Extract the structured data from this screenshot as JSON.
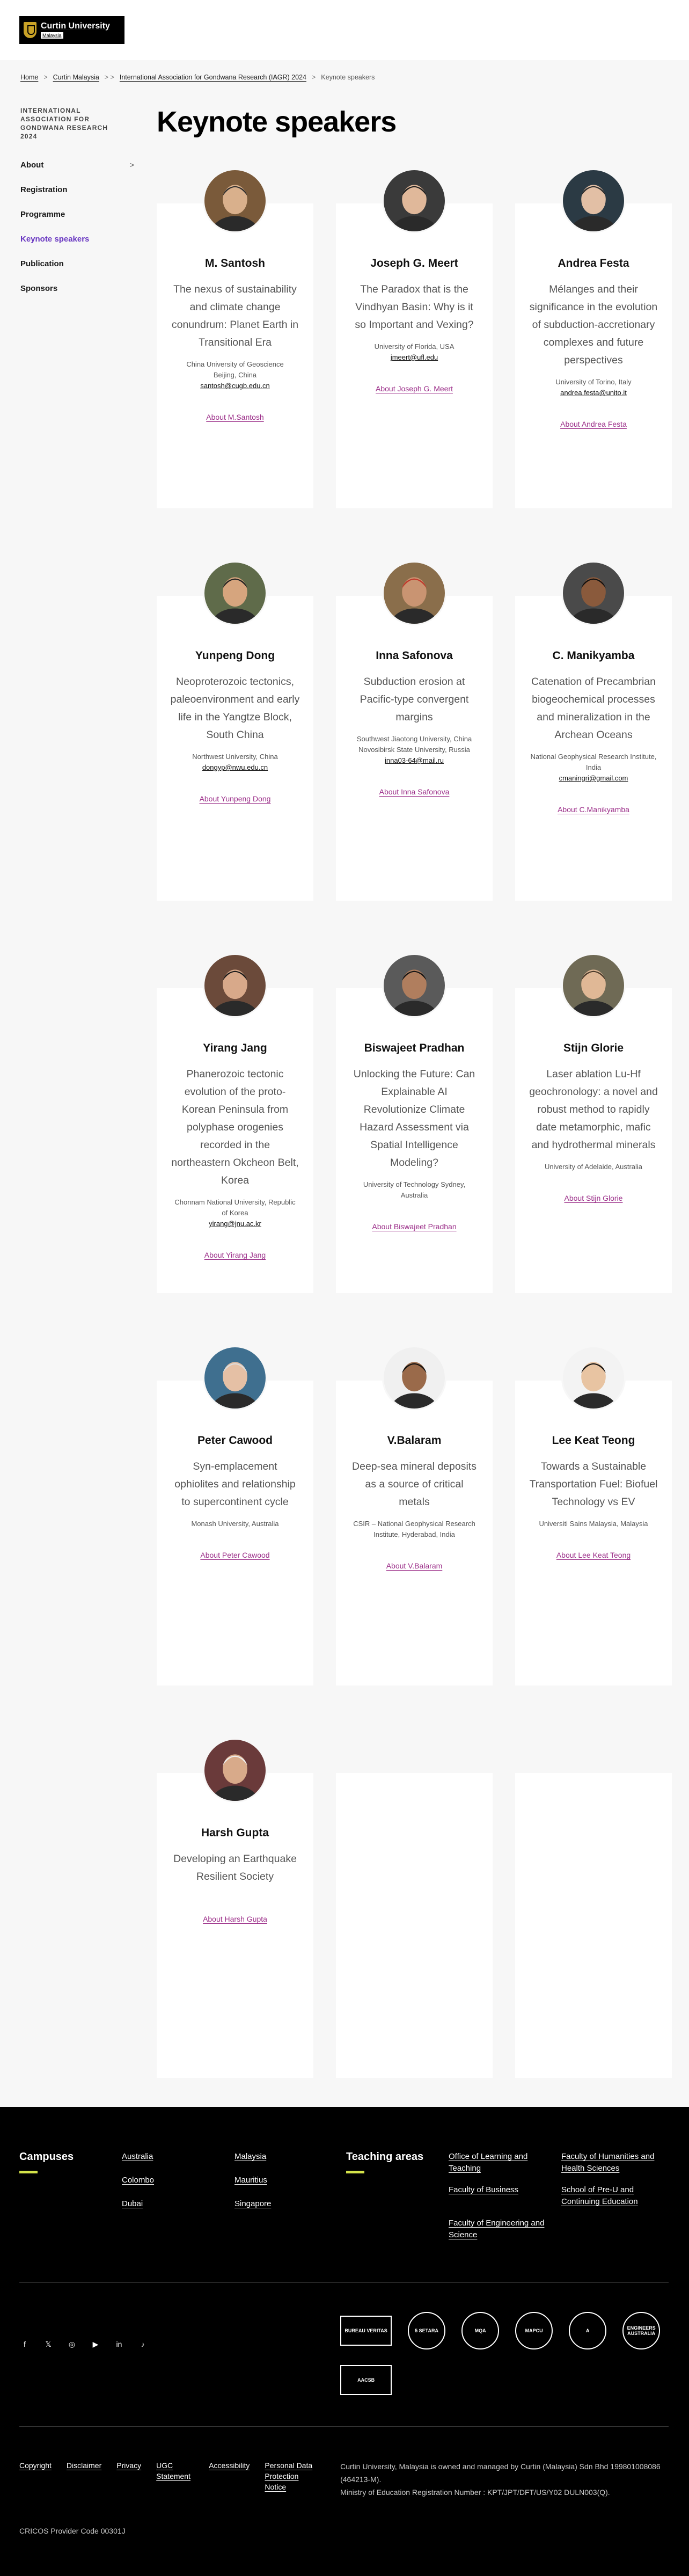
{
  "header": {
    "logo_name": "Curtin University",
    "logo_sub": "Malaysia"
  },
  "breadcrumb": {
    "home": "Home",
    "sep1": ">",
    "campus": "Curtin Malaysia",
    "sep2": "> >",
    "event": "International Association for Gondwana Research (IAGR) 2024",
    "sep3": ">",
    "current": "Keynote speakers"
  },
  "sidebar": {
    "heading": "INTERNATIONAL ASSOCIATION FOR GONDWANA RESEARCH 2024",
    "items": [
      {
        "label": "About",
        "chevron": ">"
      },
      {
        "label": "Registration"
      },
      {
        "label": "Programme"
      },
      {
        "label": "Keynote speakers"
      },
      {
        "label": "Publication"
      },
      {
        "label": "Sponsors"
      }
    ]
  },
  "page": {
    "title": "Keynote speakers"
  },
  "speakers": [
    {
      "name": "M. Santosh",
      "talk": "The nexus of sustainability and climate change conundrum: Planet Earth in Transitional Era",
      "info": [
        "China University of Geoscience",
        "Beijing, China"
      ],
      "email": "santosh@cugb.edu.cn",
      "link": "About M.Santosh"
    },
    {
      "name": "Joseph G. Meert",
      "talk": "The Paradox that is the Vindhyan Basin: Why is it so Important and Vexing?",
      "info": [
        "University of Florida, USA"
      ],
      "email": "jmeert@ufl.edu",
      "link": "About Joseph G. Meert"
    },
    {
      "name": "Andrea Festa",
      "talk": "Mélanges and their significance in the evolution of subduction-accretionary complexes and future perspectives",
      "info": [
        "University of Torino, Italy"
      ],
      "email": "andrea.festa@unito.it",
      "link": "About Andrea Festa"
    },
    {
      "name": "Yunpeng Dong",
      "talk": "Neoproterozoic tectonics, paleoenvironment and early life in the Yangtze Block, South China",
      "info": [
        "Northwest University, China"
      ],
      "email": "dongyp@nwu.edu.cn",
      "link": "About Yunpeng Dong"
    },
    {
      "name": "Inna Safonova",
      "talk": "Subduction erosion at Pacific-type convergent margins",
      "info": [
        "Southwest Jiaotong University, China",
        "Novosibirsk State University, Russia"
      ],
      "email": "inna03-64@mail.ru",
      "link": "About Inna Safonova"
    },
    {
      "name": "C. Manikyamba",
      "talk": "Catenation of Precambrian biogeochemical processes and mineralization in the Archean Oceans",
      "info": [
        "National Geophysical Research Institute, India"
      ],
      "email": "cmaningri@gmail.com",
      "link": "About C.Manikyamba"
    },
    {
      "name": "Yirang Jang",
      "talk": "Phanerozoic tectonic evolution of the proto-Korean Peninsula from polyphase orogenies recorded in the northeastern Okcheon Belt, Korea",
      "info": [
        "Chonnam National University, Republic of Korea"
      ],
      "email": "yirang@jnu.ac.kr",
      "link": "About Yirang Jang"
    },
    {
      "name": "Biswajeet Pradhan",
      "talk": "Unlocking the Future: Can Explainable AI Revolutionize Climate Hazard Assessment via Spatial Intelligence Modeling?",
      "info": [
        "University of Technology Sydney, Australia"
      ],
      "email": "",
      "link": "About Biswajeet Pradhan"
    },
    {
      "name": "Stijn Glorie",
      "talk": "Laser ablation Lu-Hf geochronology: a novel and robust method to rapidly date metamorphic, mafic and hydrothermal minerals",
      "info": [
        "University of Adelaide, Australia"
      ],
      "email": "",
      "link": "About Stijn Glorie"
    },
    {
      "name": "Peter Cawood",
      "talk": "Syn-emplacement ophiolites and relationship to supercontinent cycle",
      "info": [
        "Monash University, Australia"
      ],
      "email": "",
      "link": "About Peter Cawood"
    },
    {
      "name": "V.Balaram",
      "talk": "Deep-sea mineral deposits as a source of critical metals",
      "info": [
        "CSIR – National Geophysical Research Institute, Hyderabad, India"
      ],
      "email": "",
      "link": "About V.Balaram"
    },
    {
      "name": "Lee Keat Teong",
      "talk": "Towards a Sustainable Transportation Fuel: Biofuel Technology vs EV",
      "info": [
        "Universiti Sains Malaysia, Malaysia"
      ],
      "email": "",
      "link": "About Lee Keat Teong"
    },
    {
      "name": "Harsh Gupta",
      "talk": "Developing an Earthquake Resilient Society",
      "info": [],
      "email": "",
      "link": "About Harsh Gupta"
    }
  ],
  "footer": {
    "campuses_title": "Campuses",
    "campuses": [
      "Australia",
      "Malaysia",
      "Colombo",
      "Mauritius",
      "Dubai",
      "Singapore"
    ],
    "teaching_title": "Teaching areas",
    "teaching": [
      "Office of Learning and Teaching",
      "Faculty of Humanities and Health Sciences",
      "Faculty of Business",
      "School of Pre-U and Continuing Education",
      "Faculty of Engineering and Science"
    ],
    "social": [
      "f",
      "𝕏",
      "◎",
      "▶",
      "in",
      "♪"
    ],
    "accreds": [
      "BUREAU VERITAS",
      "5 SETARA",
      "MQA",
      "MAPCU",
      "A",
      "ENGINEERS AUSTRALIA",
      "AACSB"
    ],
    "legal_links": [
      "Copyright",
      "Disclaimer",
      "Privacy",
      "UGC Statement",
      "Accessibility",
      "Personal Data Protection Notice"
    ],
    "legal_text_1": "Curtin University, Malaysia is owned and managed by Curtin (Malaysia) Sdn Bhd 199801008086 (464213-M).",
    "legal_text_2": "Ministry of Education Registration Number : KPT/JPT/DFT/US/Y02 DULN003(Q).",
    "cricos": "CRICOS Provider Code 00301J"
  }
}
